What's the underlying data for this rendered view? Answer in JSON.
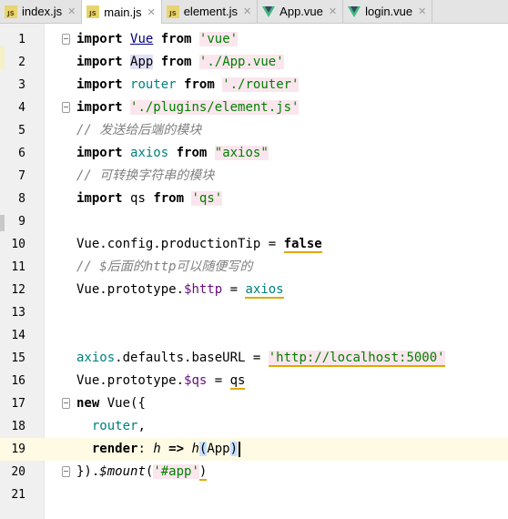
{
  "tabs": [
    {
      "label": "index.js",
      "icon": "js-file-icon",
      "active": false
    },
    {
      "label": "main.js",
      "icon": "js-file-icon",
      "active": true
    },
    {
      "label": "element.js",
      "icon": "js-file-icon",
      "active": false
    },
    {
      "label": "App.vue",
      "icon": "vue-file-icon",
      "active": false
    },
    {
      "label": "login.vue",
      "icon": "vue-file-icon",
      "active": false
    }
  ],
  "colors": {
    "keyword": "#000080",
    "string": "#008000",
    "string_bg": "#fbe6ee",
    "identifier": "#008080",
    "comment": "#808080",
    "property": "#660e7a",
    "vue_icon": "#41b883",
    "current_line": "#fffae3"
  },
  "editor": {
    "current_line": 19,
    "lines": [
      {
        "n": "1"
      },
      {
        "n": "2"
      },
      {
        "n": "3"
      },
      {
        "n": "4"
      },
      {
        "n": "5"
      },
      {
        "n": "6"
      },
      {
        "n": "7"
      },
      {
        "n": "8"
      },
      {
        "n": "9"
      },
      {
        "n": "10"
      },
      {
        "n": "11"
      },
      {
        "n": "12"
      },
      {
        "n": "13"
      },
      {
        "n": "14"
      },
      {
        "n": "15"
      },
      {
        "n": "16"
      },
      {
        "n": "17"
      },
      {
        "n": "18"
      },
      {
        "n": "19"
      },
      {
        "n": "20"
      },
      {
        "n": "21"
      }
    ],
    "tokens": {
      "import": "import",
      "from": "from",
      "Vue": "Vue",
      "vue_str": "'vue'",
      "App": "App",
      "app_str": "'./App.vue'",
      "router": "router",
      "router_str": "'./router'",
      "element_str": "'./plugins/element.js'",
      "comment5": "// 发送给后端的模块",
      "axios": "axios",
      "axios_str": "\"axios\"",
      "comment7": "// 可转换字符串的模块",
      "qs": "qs",
      "qs_str": "'qs'",
      "vue_config": "Vue.config.productionTip = ",
      "false": "false",
      "comment11": "// $后面的http可以随便写的",
      "vue_proto": "Vue.prototype.",
      "http_prop": "$http",
      "assign": " = ",
      "axios_defaults": ".defaults.baseURL = ",
      "url_str": "'http://localhost:5000'",
      "qs_prop": "$qs",
      "new": "new",
      "new_vue": " Vue({",
      "router_prop": "router",
      "comma": ",",
      "render": "render",
      "colon": ": ",
      "h": "h",
      "arrow": " => ",
      "paren_open": "(",
      "App_arg": "App",
      "paren_close": ")",
      "close_new": "}).",
      "mount": "$mount",
      "app_sel": "'#app'",
      "mount_close": ")"
    }
  }
}
